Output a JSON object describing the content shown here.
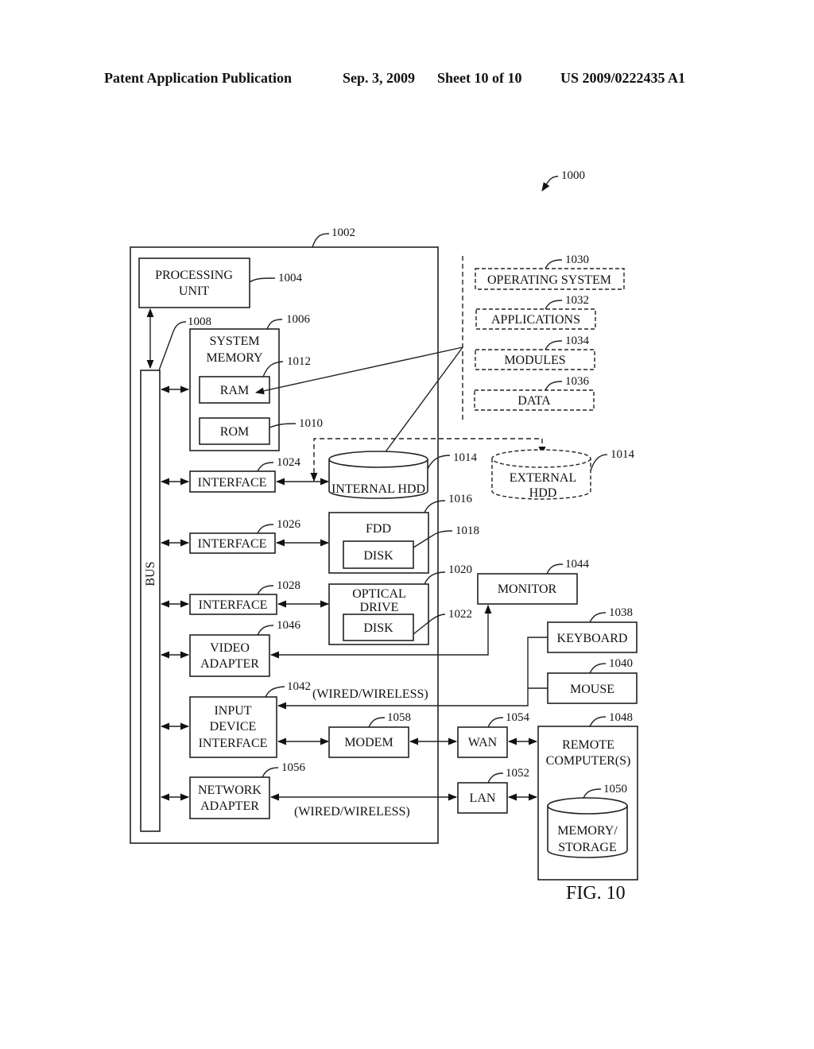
{
  "header": {
    "publication_type": "Patent Application Publication",
    "date": "Sep. 3, 2009",
    "sheet": "Sheet 10 of 10",
    "pub_number": "US 2009/0222435 A1"
  },
  "figure": {
    "label": "FIG. 10",
    "ref_system": "1000",
    "ref_computer": "1002",
    "bus_label": "BUS",
    "ref_bus": "1008",
    "processing_unit": {
      "line1": "PROCESSING",
      "line2": "UNIT",
      "ref": "1004"
    },
    "system_memory": {
      "line1": "SYSTEM",
      "line2": "MEMORY",
      "ref": "1006"
    },
    "ram": {
      "label": "RAM",
      "ref": "1012"
    },
    "rom": {
      "label": "ROM",
      "ref": "1010"
    },
    "software": [
      {
        "label": "OPERATING SYSTEM",
        "ref": "1030"
      },
      {
        "label": "APPLICATIONS",
        "ref": "1032"
      },
      {
        "label": "MODULES",
        "ref": "1034"
      },
      {
        "label": "DATA",
        "ref": "1036"
      }
    ],
    "interfaces": [
      {
        "label": "INTERFACE",
        "ref": "1024"
      },
      {
        "label": "INTERFACE",
        "ref": "1026"
      },
      {
        "label": "INTERFACE",
        "ref": "1028"
      }
    ],
    "internal_hdd": {
      "label": "INTERNAL HDD",
      "ref": "1014"
    },
    "external_hdd": {
      "line1": "EXTERNAL",
      "line2": "HDD",
      "ref": "1014"
    },
    "fdd": {
      "label": "FDD",
      "ref": "1016",
      "disk_label": "DISK",
      "disk_ref": "1018"
    },
    "optical_drive": {
      "line1": "OPTICAL",
      "line2": "DRIVE",
      "ref": "1020",
      "disk_label": "DISK",
      "disk_ref": "1022"
    },
    "video_adapter": {
      "line1": "VIDEO",
      "line2": "ADAPTER",
      "ref": "1046"
    },
    "monitor": {
      "label": "MONITOR",
      "ref": "1044"
    },
    "keyboard": {
      "label": "KEYBOARD",
      "ref": "1038"
    },
    "mouse": {
      "label": "MOUSE",
      "ref": "1040"
    },
    "input_device_interface": {
      "line1": "INPUT",
      "line2": "DEVICE",
      "line3": "INTERFACE",
      "ref": "1042"
    },
    "wired_wireless_top": "(WIRED/WIRELESS)",
    "modem": {
      "label": "MODEM",
      "ref": "1058"
    },
    "wan": {
      "label": "WAN",
      "ref": "1054"
    },
    "lan": {
      "label": "LAN",
      "ref": "1052"
    },
    "network_adapter": {
      "line1": "NETWORK",
      "line2": "ADAPTER",
      "ref": "1056"
    },
    "wired_wireless_bottom": "(WIRED/WIRELESS)",
    "remote_computers": {
      "line1": "REMOTE",
      "line2": "COMPUTER(S)",
      "ref": "1048"
    },
    "memory_storage": {
      "line1": "MEMORY/",
      "line2": "STORAGE",
      "ref": "1050"
    }
  }
}
